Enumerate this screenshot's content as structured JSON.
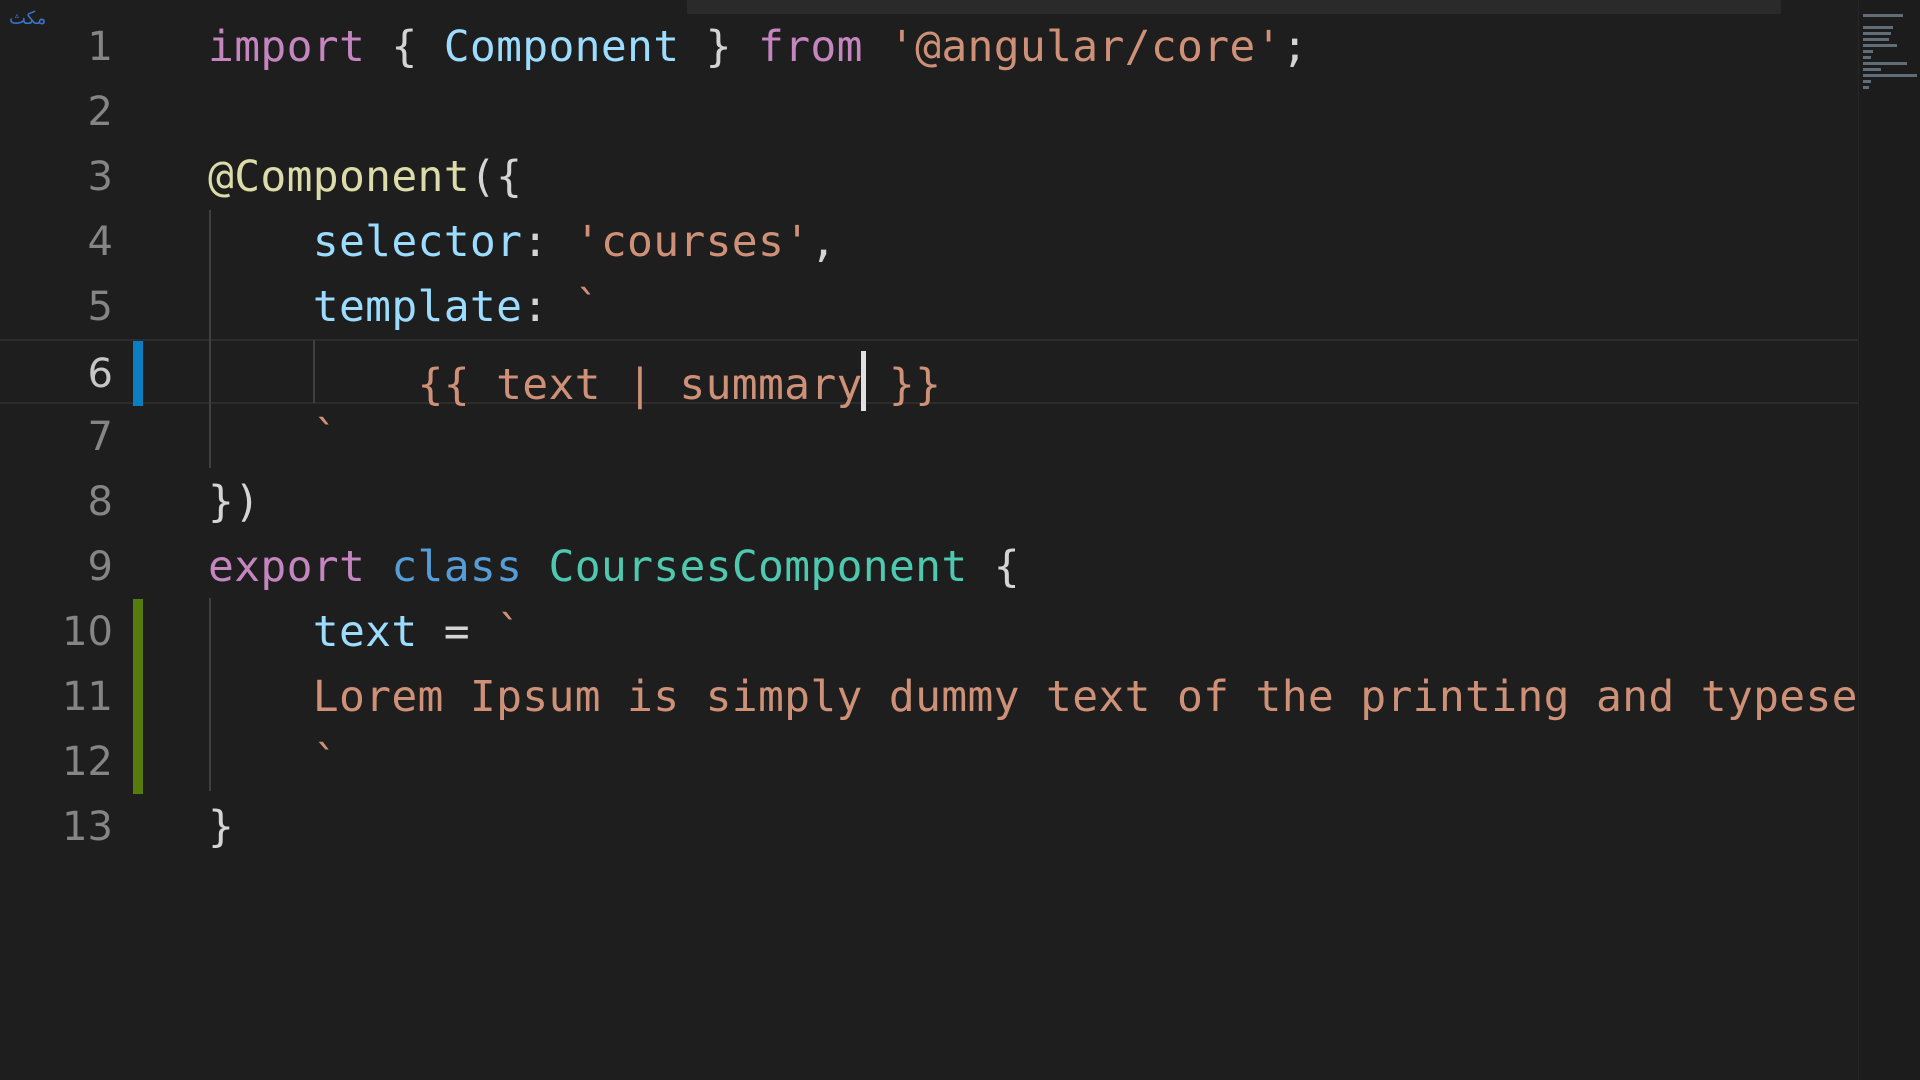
{
  "watermark": "مكث",
  "editor": {
    "active_line": 6,
    "lines": [
      {
        "number": "1",
        "tokens": [
          [
            "kw",
            "import"
          ],
          [
            "plain",
            " { "
          ],
          [
            "id",
            "Component"
          ],
          [
            "plain",
            " } "
          ],
          [
            "kw",
            "from"
          ],
          [
            "plain",
            " "
          ],
          [
            "str",
            "'@angular/core'"
          ],
          [
            "plain",
            ";"
          ]
        ]
      },
      {
        "number": "2",
        "tokens": []
      },
      {
        "number": "3",
        "tokens": [
          [
            "dec",
            "@Component"
          ],
          [
            "plain",
            "({"
          ]
        ]
      },
      {
        "number": "4",
        "tokens": [
          [
            "plain",
            "    "
          ],
          [
            "id",
            "selector"
          ],
          [
            "plain",
            ": "
          ],
          [
            "str",
            "'courses'"
          ],
          [
            "plain",
            ","
          ]
        ]
      },
      {
        "number": "5",
        "tokens": [
          [
            "plain",
            "    "
          ],
          [
            "id",
            "template"
          ],
          [
            "plain",
            ": "
          ],
          [
            "str",
            "`"
          ]
        ]
      },
      {
        "number": "6",
        "tokens": [
          [
            "plain",
            "        "
          ],
          [
            "str",
            "{{ text | summary"
          ],
          [
            "cursor",
            ""
          ],
          [
            "str",
            " }}"
          ]
        ]
      },
      {
        "number": "7",
        "tokens": [
          [
            "plain",
            "    "
          ],
          [
            "str",
            "`"
          ]
        ]
      },
      {
        "number": "8",
        "tokens": [
          [
            "plain",
            "})"
          ]
        ]
      },
      {
        "number": "9",
        "tokens": [
          [
            "kw",
            "export"
          ],
          [
            "plain",
            " "
          ],
          [
            "kw2",
            "class"
          ],
          [
            "plain",
            " "
          ],
          [
            "class",
            "CoursesComponent"
          ],
          [
            "plain",
            " {"
          ]
        ]
      },
      {
        "number": "10",
        "tokens": [
          [
            "plain",
            "    "
          ],
          [
            "id",
            "text"
          ],
          [
            "plain",
            " = "
          ],
          [
            "str",
            "`"
          ]
        ]
      },
      {
        "number": "11",
        "tokens": [
          [
            "plain",
            "    "
          ],
          [
            "str",
            "Lorem Ipsum is simply dummy text of the printing and typesetting industry."
          ]
        ]
      },
      {
        "number": "12",
        "tokens": [
          [
            "plain",
            "    "
          ],
          [
            "str",
            "`"
          ]
        ]
      },
      {
        "number": "13",
        "tokens": [
          [
            "plain",
            "}"
          ]
        ]
      }
    ],
    "gutter_marks": {
      "6": "modified",
      "10": "added",
      "11": "added",
      "12": "added"
    },
    "colors": {
      "background": "#1e1e1e",
      "keyword": "#c586c0",
      "storage": "#569cd6",
      "class": "#4ec9b0",
      "identifier": "#9cdcfe",
      "string": "#ce9178",
      "decorator": "#dcdcaa",
      "text": "#d4d4d4",
      "line_number": "#858585",
      "modified_mark": "#0c7dbe",
      "added_mark": "#587c0c"
    }
  }
}
